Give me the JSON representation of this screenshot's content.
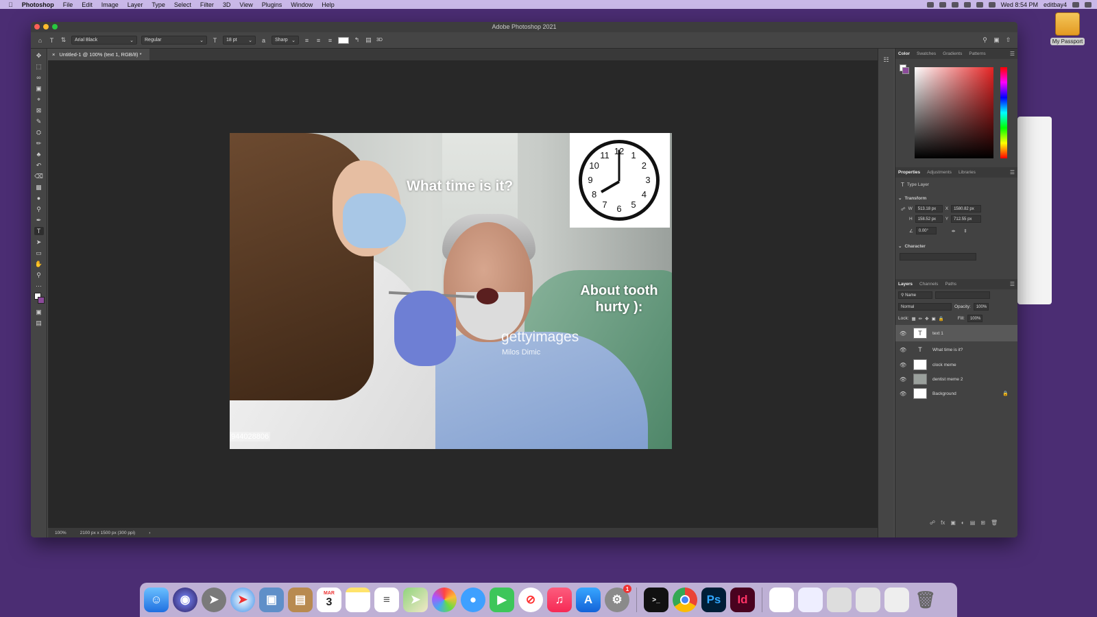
{
  "menubar": {
    "app": "Photoshop",
    "items": [
      "File",
      "Edit",
      "Image",
      "Layer",
      "Type",
      "Select",
      "Filter",
      "3D",
      "View",
      "Plugins",
      "Window",
      "Help"
    ],
    "clock": "Wed 8:54 PM",
    "user": "editbay4"
  },
  "desktop": {
    "drive_label": "My Passport"
  },
  "window": {
    "title": "Adobe Photoshop 2021"
  },
  "options": {
    "font_family": "Arial Black",
    "font_style": "Regular",
    "font_size": "18 pt",
    "antialias": "Sharp",
    "label_3d": "3D"
  },
  "document": {
    "tab_label": "Untitled-1 @ 100% (text 1, RGB/8) *",
    "zoom": "100%",
    "info": "2100 px x 1500 px (300 ppi)"
  },
  "image": {
    "text1": "What time is it?",
    "text2": "About tooth hurty ):",
    "watermark": "gettyimages",
    "credit": "Milos Dimic",
    "id_tag": "944028806",
    "clock_numbers": [
      "12",
      "1",
      "2",
      "3",
      "4",
      "5",
      "6",
      "7",
      "8",
      "9",
      "10",
      "11"
    ]
  },
  "panels": {
    "color_tabs": [
      "Color",
      "Swatches",
      "Gradients",
      "Patterns"
    ],
    "props_tabs": [
      "Properties",
      "Adjustments",
      "Libraries"
    ],
    "props": {
      "layer_type": "Type Layer",
      "transform_label": "Transform",
      "w_label": "W",
      "w": "513.18 px",
      "x_label": "X",
      "x": "1580.82 px",
      "h_label": "H",
      "h": "158.52 px",
      "y_label": "Y",
      "y": "712.55 px",
      "angle": "0.00°",
      "character_label": "Character"
    },
    "layers_tabs": [
      "Layers",
      "Channels",
      "Paths"
    ],
    "layers": {
      "filter": "Name",
      "blend": "Normal",
      "opacity_label": "Opacity:",
      "opacity": "100%",
      "lock_label": "Lock:",
      "fill_label": "Fill:",
      "fill": "100%",
      "items": [
        {
          "name": "text 1",
          "type": "T"
        },
        {
          "name": "What time is it?",
          "type": "T"
        },
        {
          "name": "clock meme",
          "type": "img"
        },
        {
          "name": "dentist meme 2",
          "type": "img"
        },
        {
          "name": "Background",
          "type": "bg"
        }
      ]
    }
  },
  "dock": {
    "apps": [
      "finder",
      "siri",
      "launchpad",
      "safari",
      "preview",
      "notebook",
      "calendar",
      "notes",
      "reminders",
      "maps",
      "photos",
      "messages",
      "facetime",
      "news",
      "music",
      "app-store",
      "system-preferences",
      "terminal",
      "chrome",
      "photoshop",
      "indesign"
    ],
    "calendar_month": "MAR",
    "calendar_day": "3",
    "ps_label": "Ps",
    "id_label": "Id",
    "badge": "1"
  }
}
